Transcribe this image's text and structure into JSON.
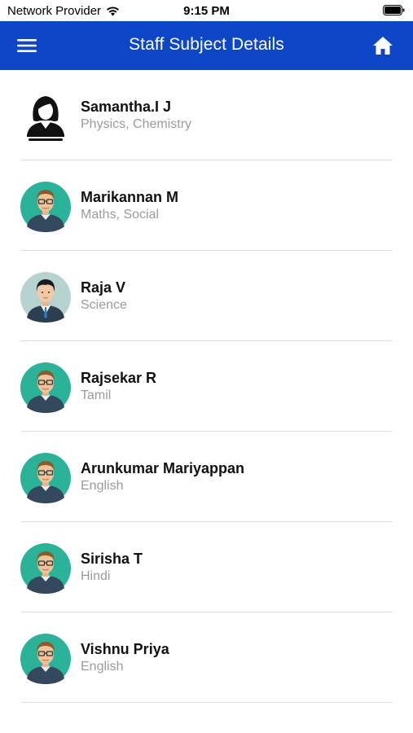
{
  "status_bar": {
    "carrier": "Network Provider",
    "time": "9:15 PM"
  },
  "header": {
    "title": "Staff Subject Details",
    "menu_icon": "hamburger-menu-icon",
    "home_icon": "home-icon",
    "color": "#0d47c8"
  },
  "staff": [
    {
      "name": "Samantha.I J",
      "subjects": "Physics, Chemistry",
      "avatar": "female"
    },
    {
      "name": "Marikannan M",
      "subjects": "Maths, Social",
      "avatar": "male-glasses"
    },
    {
      "name": "Raja V",
      "subjects": "Science",
      "avatar": "male-suit"
    },
    {
      "name": "Rajsekar R",
      "subjects": "Tamil",
      "avatar": "male-glasses"
    },
    {
      "name": "Arunkumar Mariyappan",
      "subjects": "English",
      "avatar": "male-glasses"
    },
    {
      "name": "Sirisha T",
      "subjects": "Hindi",
      "avatar": "male-glasses"
    },
    {
      "name": "Vishnu Priya",
      "subjects": "English",
      "avatar": "male-glasses"
    }
  ]
}
